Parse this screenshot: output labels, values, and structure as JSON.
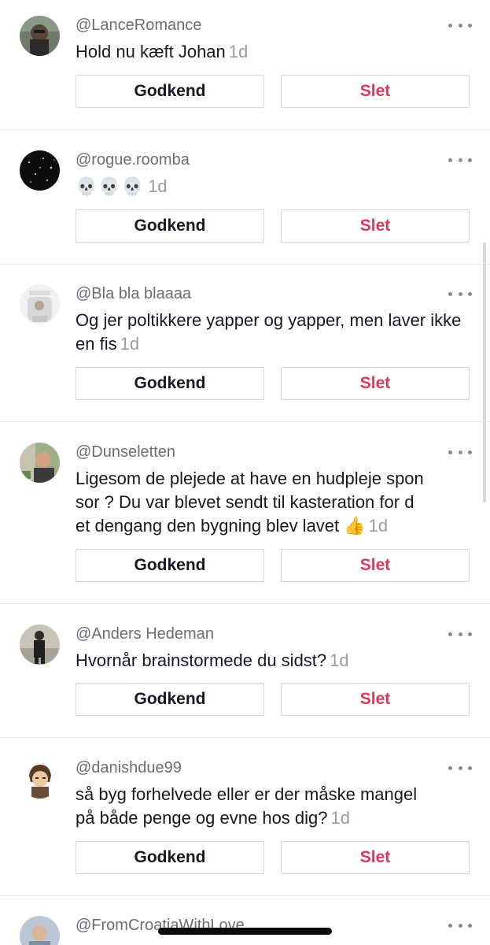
{
  "comments": [
    {
      "username": "@LanceRomance",
      "text": "Hold nu kæft Johan",
      "time": "1d",
      "approve_label": "Godkend",
      "delete_label": "Slet"
    },
    {
      "username": "@rogue.roomba",
      "text": "💀💀💀",
      "time": "1d",
      "approve_label": "Godkend",
      "delete_label": "Slet"
    },
    {
      "username": "@Bla bla blaaaa",
      "text": "Og jer poltikkere yapper og yapper, men laver ikke en fis",
      "time": "1d",
      "approve_label": "Godkend",
      "delete_label": "Slet"
    },
    {
      "username": "@Dunseletten",
      "text_lines": [
        "Ligesom de plejede at have en hudpleje spon",
        "sor ? Du var blevet sendt til kasteration for d",
        "et dengang den bygning blev lavet 👍"
      ],
      "time": "1d",
      "approve_label": "Godkend",
      "delete_label": "Slet"
    },
    {
      "username": "@Anders Hedeman",
      "text": "Hvornår brainstormede du sidst?",
      "time": "1d",
      "approve_label": "Godkend",
      "delete_label": "Slet"
    },
    {
      "username": "@danishdue99",
      "text_lines": [
        "så byg forhelvede eller er der måske mangel",
        "på både penge og evne hos dig?"
      ],
      "time": "1d",
      "approve_label": "Godkend",
      "delete_label": "Slet"
    },
    {
      "username": "@FromCroatiaWithLove"
    }
  ],
  "icons": {
    "more": "more-options-icon"
  },
  "colors": {
    "delete": "#e0365a",
    "username": "#6b6d75",
    "time": "#9a9ba1"
  }
}
